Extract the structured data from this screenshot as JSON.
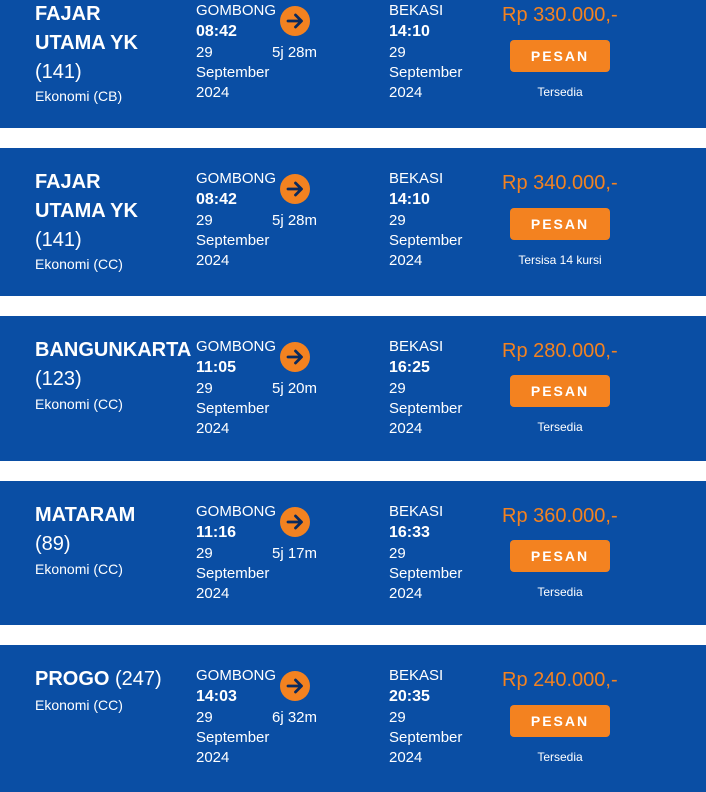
{
  "colors": {
    "card_bg": "#0a4ea4",
    "accent": "#f38220",
    "page_bg": "#ffffff"
  },
  "icons": {
    "arrow": "arrow-right-icon"
  },
  "trains": [
    {
      "name_line1": "FAJAR",
      "name_line2": "UTAMA YK",
      "number": "(141)",
      "class": "Ekonomi (CB)",
      "origin": "GOMBONG",
      "depart_time": "08:42",
      "depart_date_day": "29",
      "depart_date_month": "September",
      "depart_date_year": "2024",
      "duration": "5j 28m",
      "destination": "BEKASI",
      "arrive_time": "14:10",
      "arrive_date_day": "29",
      "arrive_date_month": "September",
      "arrive_date_year": "2024",
      "price": "Rp 330.000,-",
      "button": "PESAN",
      "availability": "Tersedia"
    },
    {
      "name_line1": "FAJAR",
      "name_line2": "UTAMA YK",
      "number": "(141)",
      "class": "Ekonomi (CC)",
      "origin": "GOMBONG",
      "depart_time": "08:42",
      "depart_date_day": "29",
      "depart_date_month": "September",
      "depart_date_year": "2024",
      "duration": "5j 28m",
      "destination": "BEKASI",
      "arrive_time": "14:10",
      "arrive_date_day": "29",
      "arrive_date_month": "September",
      "arrive_date_year": "2024",
      "price": "Rp 340.000,-",
      "button": "PESAN",
      "availability": "Tersisa 14 kursi"
    },
    {
      "name_line1": "BANGUNKARTA",
      "number": "(123)",
      "class": "Ekonomi (CC)",
      "origin": "GOMBONG",
      "depart_time": "11:05",
      "depart_date_day": "29",
      "depart_date_month": "September",
      "depart_date_year": "2024",
      "duration": "5j 20m",
      "destination": "BEKASI",
      "arrive_time": "16:25",
      "arrive_date_day": "29",
      "arrive_date_month": "September",
      "arrive_date_year": "2024",
      "price": "Rp 280.000,-",
      "button": "PESAN",
      "availability": "Tersedia"
    },
    {
      "name_line1": "MATARAM",
      "number": "(89)",
      "class": "Ekonomi (CC)",
      "origin": "GOMBONG",
      "depart_time": "11:16",
      "depart_date_day": "29",
      "depart_date_month": "September",
      "depart_date_year": "2024",
      "duration": "5j 17m",
      "destination": "BEKASI",
      "arrive_time": "16:33",
      "arrive_date_day": "29",
      "arrive_date_month": "September",
      "arrive_date_year": "2024",
      "price": "Rp 360.000,-",
      "button": "PESAN",
      "availability": "Tersedia"
    },
    {
      "name_line1": "PROGO",
      "number": "(247)",
      "class": "Ekonomi (CC)",
      "origin": "GOMBONG",
      "depart_time": "14:03",
      "depart_date_day": "29",
      "depart_date_month": "September",
      "depart_date_year": "2024",
      "duration": "6j 32m",
      "destination": "BEKASI",
      "arrive_time": "20:35",
      "arrive_date_day": "29",
      "arrive_date_month": "September",
      "arrive_date_year": "2024",
      "price": "Rp 240.000,-",
      "button": "PESAN",
      "availability": "Tersedia"
    }
  ]
}
